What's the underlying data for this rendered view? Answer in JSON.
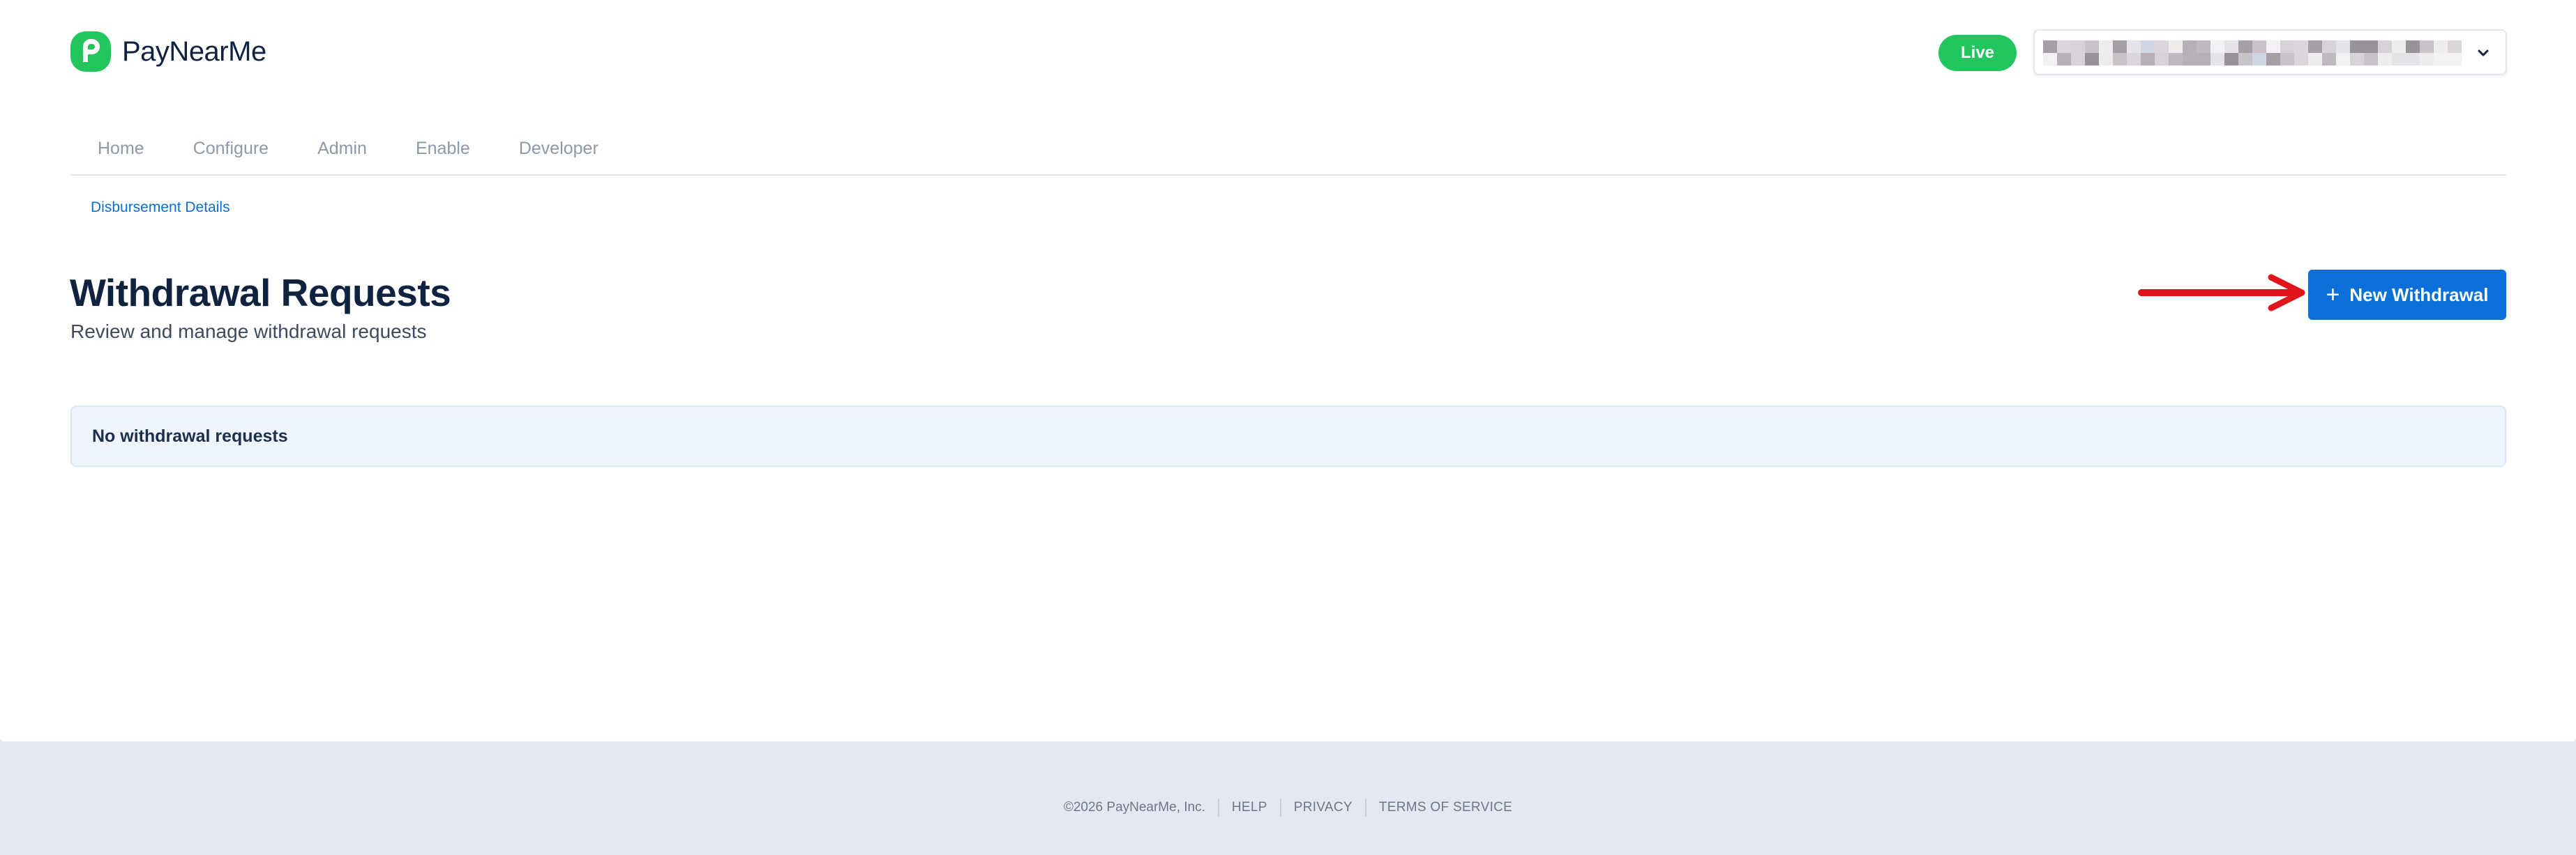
{
  "brand": {
    "name": "PayNearMe",
    "color": "#22c55e"
  },
  "header": {
    "live_badge": "Live",
    "account_select": {
      "value": "",
      "icon": "chevron-down-icon"
    }
  },
  "nav": {
    "items": [
      {
        "label": "Home"
      },
      {
        "label": "Configure"
      },
      {
        "label": "Admin"
      },
      {
        "label": "Enable"
      },
      {
        "label": "Developer"
      }
    ]
  },
  "subnav": {
    "link": "Disbursement Details"
  },
  "page": {
    "title": "Withdrawal Requests",
    "subtitle": "Review and manage withdrawal requests",
    "new_button": {
      "label": "New Withdrawal",
      "icon": "plus-icon"
    },
    "empty_state": "No withdrawal requests"
  },
  "annotation": {
    "arrow_color": "#e0151b"
  },
  "colors": {
    "primary": "#0a6fd8",
    "live": "#22c55e",
    "empty_bg": "#eef5fe"
  },
  "footer": {
    "copyright": "©2026 PayNearMe, Inc.",
    "links": [
      {
        "label": "HELP"
      },
      {
        "label": "PRIVACY"
      },
      {
        "label": "TERMS OF SERVICE"
      }
    ]
  }
}
